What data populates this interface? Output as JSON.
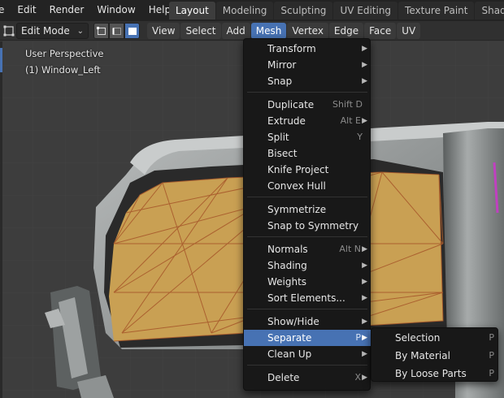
{
  "topbar": {
    "menus": [
      "e",
      "Edit",
      "Render",
      "Window",
      "Help"
    ],
    "workspaces": [
      {
        "label": "Layout",
        "active": true
      },
      {
        "label": "Modeling",
        "active": false
      },
      {
        "label": "Sculpting",
        "active": false
      },
      {
        "label": "UV Editing",
        "active": false
      },
      {
        "label": "Texture Paint",
        "active": false
      },
      {
        "label": "Shading",
        "active": false
      }
    ]
  },
  "header": {
    "mode": "Edit Mode",
    "menus": [
      "View",
      "Select",
      "Add",
      "Mesh",
      "Vertex",
      "Edge",
      "Face",
      "UV"
    ],
    "active_menu": "Mesh"
  },
  "viewport": {
    "perspective": "User Perspective",
    "object": "(1) Window_Left"
  },
  "mesh_menu": {
    "items": [
      {
        "label": "Transform",
        "shortcut": "",
        "submenu": true
      },
      {
        "label": "Mirror",
        "shortcut": "",
        "submenu": true
      },
      {
        "label": "Snap",
        "shortcut": "",
        "submenu": true
      },
      {
        "label": "Duplicate",
        "shortcut": "Shift D",
        "submenu": false
      },
      {
        "label": "Extrude",
        "shortcut": "Alt E",
        "submenu": true
      },
      {
        "label": "Split",
        "shortcut": "Y",
        "submenu": false
      },
      {
        "label": "Bisect",
        "shortcut": "",
        "submenu": false
      },
      {
        "label": "Knife Project",
        "shortcut": "",
        "submenu": false
      },
      {
        "label": "Convex Hull",
        "shortcut": "",
        "submenu": false
      },
      {
        "label": "Symmetrize",
        "shortcut": "",
        "submenu": false
      },
      {
        "label": "Snap to Symmetry",
        "shortcut": "",
        "submenu": false
      },
      {
        "label": "Normals",
        "shortcut": "Alt N",
        "submenu": true
      },
      {
        "label": "Shading",
        "shortcut": "",
        "submenu": true
      },
      {
        "label": "Weights",
        "shortcut": "",
        "submenu": true
      },
      {
        "label": "Sort Elements...",
        "shortcut": "",
        "submenu": true
      },
      {
        "label": "Show/Hide",
        "shortcut": "",
        "submenu": true
      },
      {
        "label": "Separate",
        "shortcut": "P",
        "submenu": true,
        "active": true
      },
      {
        "label": "Clean Up",
        "shortcut": "",
        "submenu": true
      },
      {
        "label": "Delete",
        "shortcut": "X",
        "submenu": true
      }
    ]
  },
  "separate_submenu": {
    "items": [
      {
        "label": "Selection",
        "shortcut": "P"
      },
      {
        "label": "By Material",
        "shortcut": "P"
      },
      {
        "label": "By Loose Parts",
        "shortcut": "P"
      }
    ]
  },
  "colors": {
    "accent": "#4772b3",
    "menu_bg": "#181818",
    "face_fill": "#c9a053",
    "wire": "#a85a2c"
  }
}
